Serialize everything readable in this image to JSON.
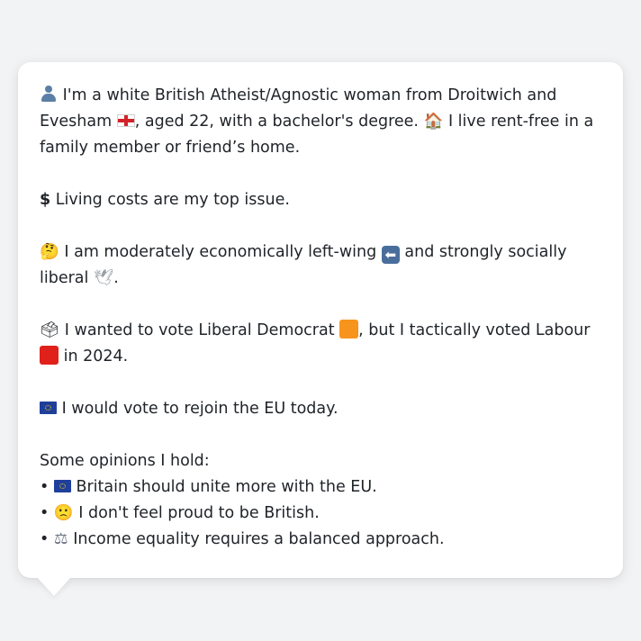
{
  "profile": {
    "intro_part1": "I'm a white British Atheist/Agnostic woman from Droitwich and Evesham",
    "intro_part2": ", aged 22, with a bachelor's degree.",
    "intro_part3": "I live rent-free in a family member or friend’s home.",
    "top_issue": "Living costs are my top issue.",
    "politics_part1": "I am moderately economically left-wing",
    "politics_part2": "and strongly socially liberal",
    "politics_part3": ".",
    "vote_part1": "I wanted to vote Liberal Democrat",
    "vote_part2": ", but I tactically voted Labour",
    "vote_part3": "in 2024.",
    "eu": "I would vote to rejoin the EU today.",
    "opinions_heading": "Some opinions I hold:",
    "bullet_char": "•",
    "opinions": [
      "Britain should unite more with the EU.",
      "I don't feel proud to be British.",
      "Income equality requires a balanced approach."
    ]
  },
  "icons": {
    "person": "person-silhouette-icon",
    "england_flag": "england-flag-icon",
    "house": "house-icon",
    "dollar": "dollar-sign-icon",
    "thinking": "thinking-face-icon",
    "left_arrow": "left-arrow-icon",
    "dove": "dove-icon",
    "ballot": "ballot-box-icon",
    "lib_dem": "orange-square-icon",
    "labour": "red-square-icon",
    "eu_flag": "eu-flag-icon",
    "frown": "slightly-frowning-face-icon",
    "scales": "balance-scale-icon"
  },
  "colors": {
    "background": "#f2f3f5",
    "card": "#ffffff",
    "text": "#1f2328",
    "lib_dem_orange": "#f7941d",
    "labour_red": "#e0201b",
    "eu_blue": "#1f3f9a"
  }
}
